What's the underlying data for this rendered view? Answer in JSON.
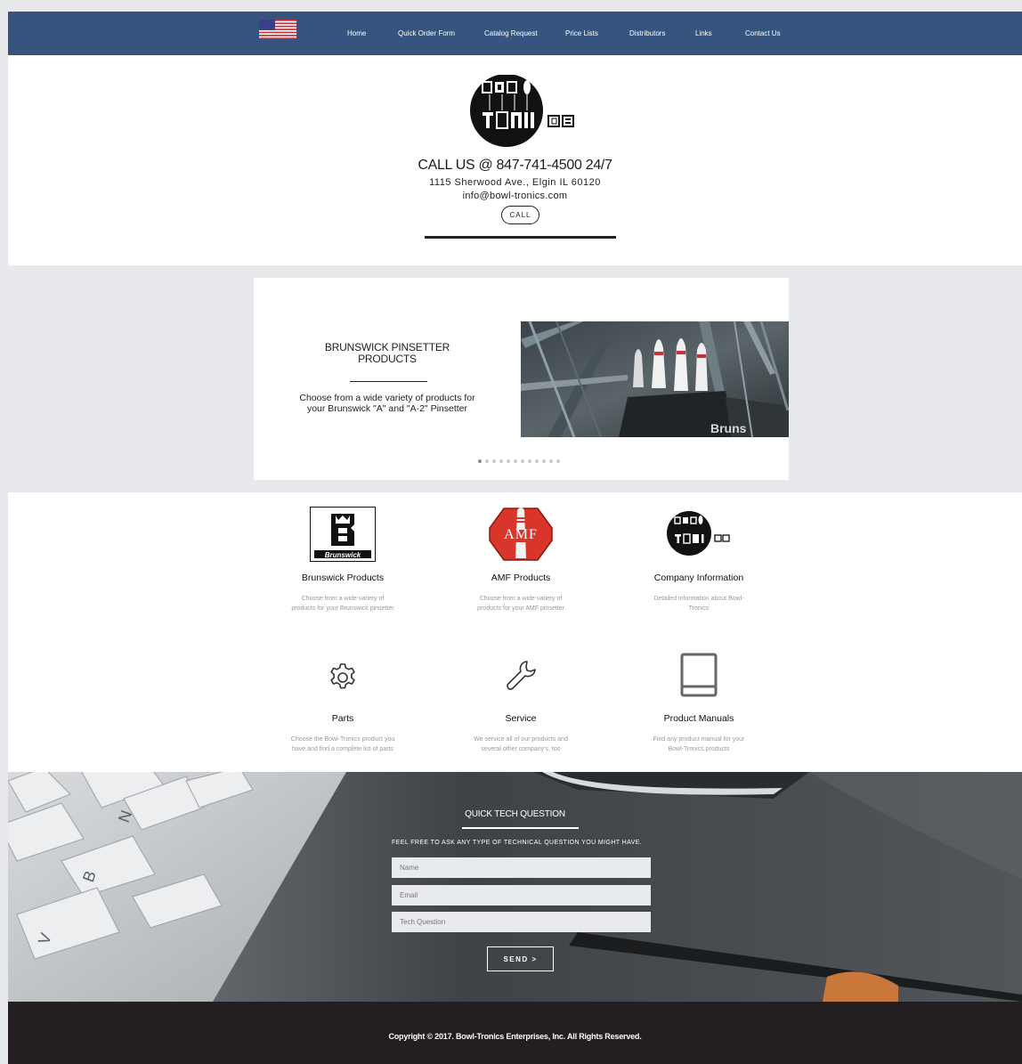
{
  "nav": {
    "items": [
      {
        "label": "Home"
      },
      {
        "label": "Quick Order Form"
      },
      {
        "label": "Catalog Request"
      },
      {
        "label": "Price Lists"
      },
      {
        "label": "Distributors"
      },
      {
        "label": "Links"
      },
      {
        "label": "Contact Us"
      }
    ]
  },
  "header": {
    "logo_text": "BOWL TRONICS",
    "call_line": "CALL US @ 847-741-4500 24/7",
    "address": "1115 Sherwood Ave., Elgin IL 60120",
    "email": "info@bowl-tronics.com",
    "call_button": "CALL"
  },
  "slider": {
    "title": "BRUNSWICK PINSETTER PRODUCTS",
    "description": "Choose from a wide variety of products for your Brunswick \"A\" and \"A-2\" Pinsetter",
    "photo_caption": "Bruns",
    "dot_count": 12,
    "active_dot": 1
  },
  "features": [
    {
      "title": "Brunswick Products",
      "desc": "Choose from a wide variety of products for your Brunswick pinsetter",
      "icon": "brunswick-logo",
      "logo_text": "Brunswick"
    },
    {
      "title": "AMF Products",
      "desc": "Choose from a wide variety of products for your AMF pinsetter",
      "icon": "amf-logo",
      "logo_text": "AMF"
    },
    {
      "title": "Company Information",
      "desc": "Detailed information about Bowl-Tronics",
      "icon": "bowl-tronics-logo"
    },
    {
      "title": "Parts",
      "desc": "Choose the Bowl-Tronics product you have and find a complete list of parts",
      "icon": "gear-icon"
    },
    {
      "title": "Service",
      "desc": "We service all of our products and several other company's, too",
      "icon": "wrench-icon"
    },
    {
      "title": "Product Manuals",
      "desc": "Find any product manual for your Bowl-Tronics products",
      "icon": "book-icon"
    }
  ],
  "question": {
    "title": "QUICK TECH QUESTION",
    "subtitle": "FEEL FREE TO ASK ANY TYPE OF TECHNICAL QUESTION YOU MIGHT HAVE.",
    "name_placeholder": "Name",
    "email_placeholder": "Email",
    "question_placeholder": "Tech Question",
    "send_label": "SEND >"
  },
  "footer": {
    "copyright": "Copyright © 2017. Bowl-Tronics Enterprises, Inc. All Rights Reserved."
  },
  "colors": {
    "nav_bg": "#35557f",
    "footer_bg": "#231f20",
    "amf_red": "#d9352b"
  }
}
